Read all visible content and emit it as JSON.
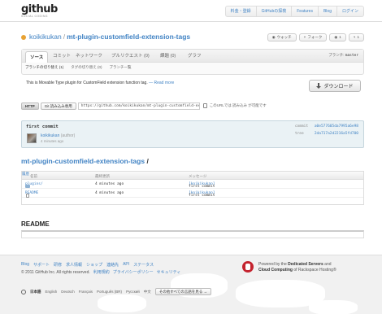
{
  "header": {
    "logo": "github",
    "logo_sub": "SOCIAL CODING",
    "nav": [
      "料金・登録",
      "GitHubの探検",
      "Features",
      "Blog",
      "ログイン"
    ]
  },
  "repo": {
    "owner": "koikikukan",
    "separator": "/",
    "name": "mt-plugin-customfield-extension-tags",
    "watch_label": "ウォッチ",
    "fork_label": "フォーク",
    "watchers": "1",
    "forks": "1"
  },
  "tabs": {
    "items": [
      "ソース",
      "コミット",
      "ネットワーク",
      "プルリクエスト (0)",
      "課題 (0)",
      "グラフ"
    ],
    "branch_label": "ブランチ:",
    "branch_value": "master",
    "subtabs": [
      "ブランチの切り替え (1)",
      "タグの切り替え (0)",
      "ブランチ一覧"
    ]
  },
  "description": {
    "text": "This is Movable Type plugin for CustomField extension function tag.",
    "read_more": "— Read more",
    "download_label": "ダウンロード"
  },
  "clone": {
    "http_label": "HTTP",
    "git_ro_label": "Git 読み込み専用",
    "url": "https://github.com/koikikukan/mt-plugin-customfield-extension-tags.git",
    "note": "このURLでは 読み込み が可能です"
  },
  "commit": {
    "message": "first commit",
    "author": "koikikukan",
    "role": "(author)",
    "age": "4 minutes ago",
    "commit_key": "commit",
    "commit_hash": "a0e577605da7995a6e98",
    "tree_key": "tree",
    "tree_hash": "2da717a2d2216a5fd700"
  },
  "tree": {
    "title": "mt-plugin-customfield-extension-tags",
    "title_slash": "/",
    "headers": {
      "name": "名前",
      "age": "最終更新",
      "message": "メッセージ",
      "history": "履歴"
    },
    "rows": [
      {
        "name": "plugins/",
        "type": "folder",
        "age": "4 minutes ago",
        "message": "first commit",
        "author": "[koikikukan]"
      },
      {
        "name": "README",
        "type": "file",
        "age": "4 minutes ago",
        "message": "first commit",
        "author": "[koikikukan]"
      }
    ]
  },
  "readme": {
    "title": "README"
  },
  "footer": {
    "links": [
      "Blog",
      "サポート",
      "研修",
      "求人情報",
      "ショップ",
      "連絡先",
      "API",
      "ステータス"
    ],
    "copyright": "© 2011 GitHub Inc. All rights reserved.",
    "legal": [
      "利用規約",
      "プライバシーポリシー",
      "セキュリティ"
    ],
    "rackspace_line1_prefix": "Powered by the",
    "rackspace_line1_bold": "Dedicated Servers",
    "rackspace_line1_suffix": "and",
    "rackspace_line2_bold": "Cloud Computing",
    "rackspace_line2_suffix": "of Rackspace Hosting®",
    "languages": [
      "日本語",
      "English",
      "Deutsch",
      "Français",
      "Português (BR)",
      "Русский",
      "中文"
    ],
    "more_languages": "その他すべての言語を見る →"
  },
  "colors": {
    "link": "#4183c4",
    "commit_bg": "#eaf2f5",
    "rackspace_red": "#c4232e"
  }
}
